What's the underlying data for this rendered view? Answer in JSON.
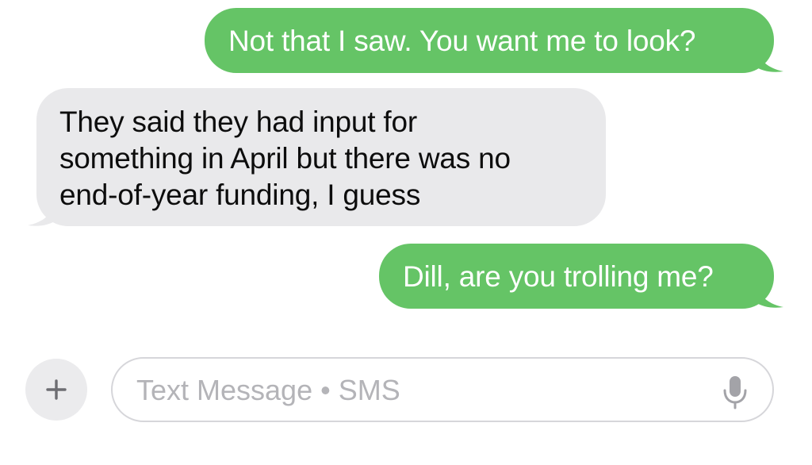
{
  "conversation": {
    "messages": [
      {
        "direction": "sent",
        "text": "Not that I saw. You want me to look?"
      },
      {
        "direction": "received",
        "text": "They said they had input for\nsomething in April but there was no\nend-of-year funding, I guess"
      },
      {
        "direction": "sent",
        "text": "Dill, are you trolling me?"
      }
    ]
  },
  "compose": {
    "placeholder": "Text Message • SMS",
    "add_icon": "plus-icon",
    "mic_icon": "microphone-icon"
  },
  "colors": {
    "sent_bubble": "#65c466",
    "received_bubble": "#e9e9eb",
    "placeholder_text": "#b4b4b8"
  }
}
